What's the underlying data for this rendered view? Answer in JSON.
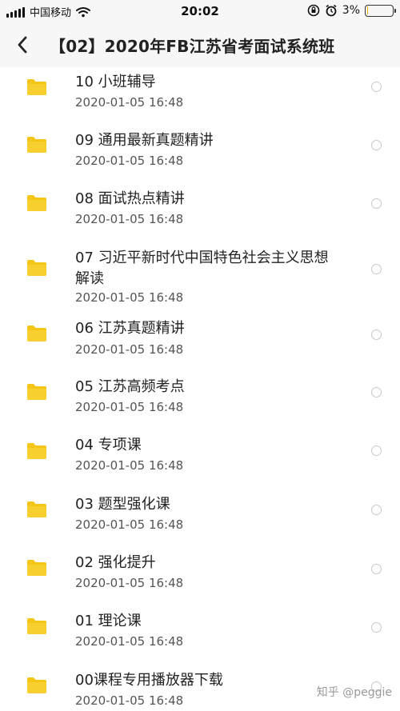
{
  "status_bar": {
    "carrier": "中国移动",
    "time": "20:02",
    "battery_percent": "3%",
    "battery_level": 0.03
  },
  "header": {
    "title": "【02】2020年FB江苏省考面试系统班",
    "back_icon": "chevron-left-icon"
  },
  "items": [
    {
      "title": "10 小班辅导",
      "date": "2020-01-05 16:48"
    },
    {
      "title": "09 通用最新真题精讲",
      "date": "2020-01-05 16:48"
    },
    {
      "title": "08 面试热点精讲",
      "date": "2020-01-05 16:48"
    },
    {
      "title": "07 习近平新时代中国特色社会主义思想解读",
      "date": "2020-01-05 16:48"
    },
    {
      "title": "06 江苏真题精讲",
      "date": "2020-01-05 16:48"
    },
    {
      "title": "05 江苏高频考点",
      "date": "2020-01-05 16:48"
    },
    {
      "title": "04 专项课",
      "date": "2020-01-05 16:48"
    },
    {
      "title": "03 题型强化课",
      "date": "2020-01-05 16:48"
    },
    {
      "title": "02 强化提升",
      "date": "2020-01-05 16:48"
    },
    {
      "title": "01 理论课",
      "date": "2020-01-05 16:48"
    },
    {
      "title": "00课程专用播放器下载",
      "date": "2020-01-05 16:48"
    }
  ],
  "watermark": "知乎 @peggie",
  "colors": {
    "folder": "#f5c518",
    "battery": "#e8b400"
  }
}
